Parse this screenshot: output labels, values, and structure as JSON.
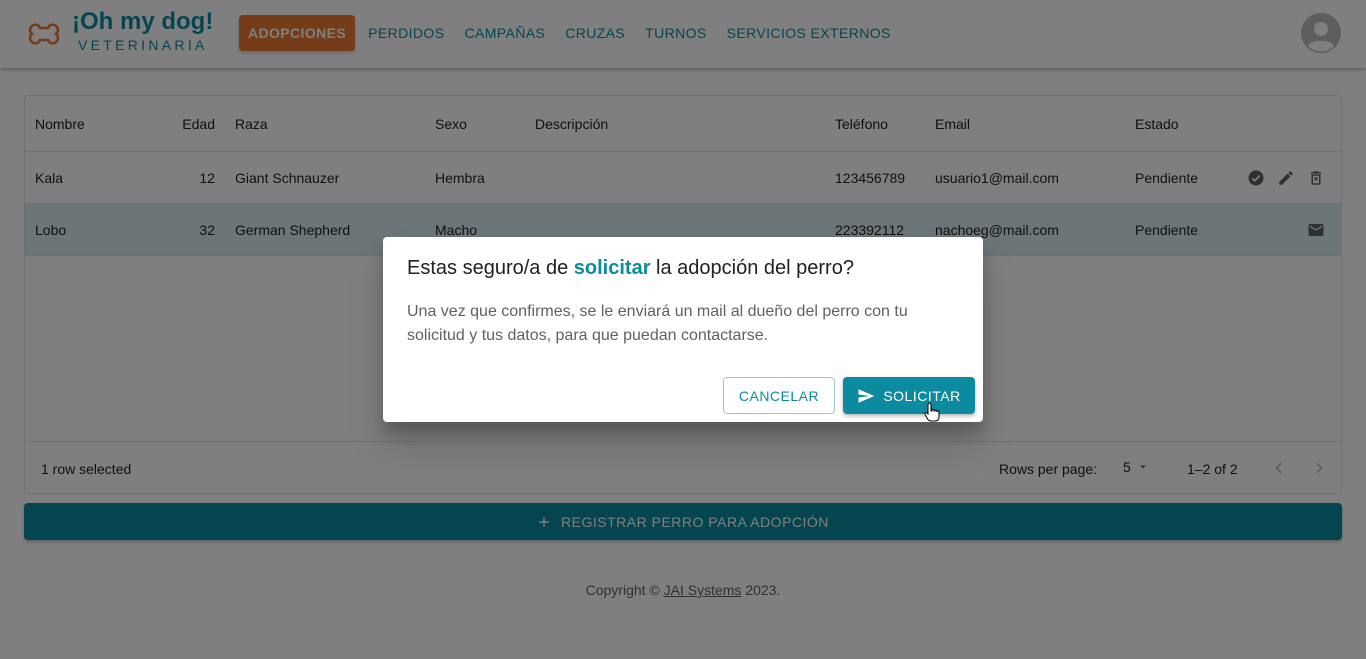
{
  "colors": {
    "primary": "#0b8aa0",
    "accent": "#e87830"
  },
  "brand": {
    "title": "¡Oh my dog!",
    "subtitle": "VETERINARIA"
  },
  "nav": {
    "items": [
      "ADOPCIONES",
      "PERDIDOS",
      "CAMPAÑAS",
      "CRUZAS",
      "TURNOS",
      "SERVICIOS EXTERNOS"
    ],
    "active": "ADOPCIONES"
  },
  "table": {
    "columns": [
      "Nombre",
      "Edad",
      "Raza",
      "Sexo",
      "Descripción",
      "Teléfono",
      "Email",
      "Estado"
    ],
    "rows": [
      {
        "nombre": "Kala",
        "edad": "12",
        "raza": "Giant Schnauzer",
        "sexo": "Hembra",
        "descripcion": "",
        "telefono": "123456789",
        "email": "usuario1@mail.com",
        "estado": "Pendiente",
        "actions": [
          "check-circle-icon",
          "edit-icon",
          "delete-icon"
        ]
      },
      {
        "nombre": "Lobo",
        "edad": "32",
        "raza": "German Shepherd",
        "sexo": "Macho",
        "descripcion": "",
        "telefono": "223392112",
        "email": "nachoeg@mail.com",
        "estado": "Pendiente",
        "actions": [
          "mail-icon"
        ],
        "selected": true
      }
    ],
    "footer": {
      "selected_text": "1 row selected",
      "rows_per_page_label": "Rows per page:",
      "rows_per_page_value": "5",
      "range": "1–2 of 2"
    }
  },
  "register_button": "REGISTRAR PERRO PARA ADOPCIÓN",
  "copyright": {
    "prefix": "Copyright ©",
    "link": "JAI Systems",
    "suffix": "2023."
  },
  "dialog": {
    "title_before": "Estas seguro/a de",
    "title_highlight": "solicitar",
    "title_after": "la adopción del perro?",
    "body": "Una vez que confirmes, se le enviará un mail al dueño del perro con tu solicitud y tus datos, para que puedan contactarse.",
    "cancel_label": "CANCELAR",
    "confirm_label": "SOLICITAR"
  }
}
